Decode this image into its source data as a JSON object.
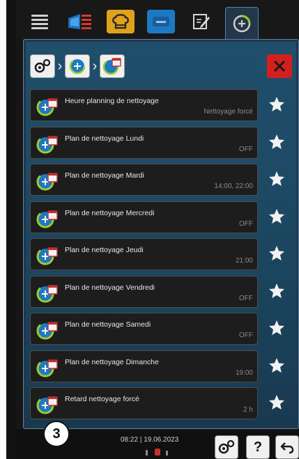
{
  "topbar": {
    "icons": [
      "menu-icon",
      "heat-icon",
      "chef-hat-icon",
      "message-icon",
      "edit-icon",
      "cleaning-icon"
    ]
  },
  "breadcrumb": {
    "icons": [
      "settings-icon",
      "cleaning-icon",
      "cleaning-schedule-icon"
    ]
  },
  "rows": [
    {
      "label": "Heure planning de nettoyage",
      "value": "Nettoyage forcé"
    },
    {
      "label": "Plan de nettoyage Lundi",
      "value": "OFF"
    },
    {
      "label": "Plan de nettoyage Mardi",
      "value": "14:00, 22:00"
    },
    {
      "label": "Plan de nettoyage Mercredi",
      "value": "OFF"
    },
    {
      "label": "Plan de nettoyage Jeudi",
      "value": "21:00"
    },
    {
      "label": "Plan de nettoyage Vendredi",
      "value": "OFF"
    },
    {
      "label": "Plan de nettoyage Samedi",
      "value": "OFF"
    },
    {
      "label": "Plan de nettoyage Dimanche",
      "value": "19:00"
    },
    {
      "label": "Retard nettoyage forcé",
      "value": "2 h"
    }
  ],
  "bottombar": {
    "badge": "3",
    "time": "08:22",
    "separator": "|",
    "date": "19.06.2023",
    "help_label": "?"
  },
  "colors": {
    "accent_blue": "#1e79c4",
    "toque_yellow": "#e0a21a",
    "close_red": "#d51f1f",
    "panel_teal": "#1f4f6b",
    "ring_green": "#9ccc2c"
  }
}
